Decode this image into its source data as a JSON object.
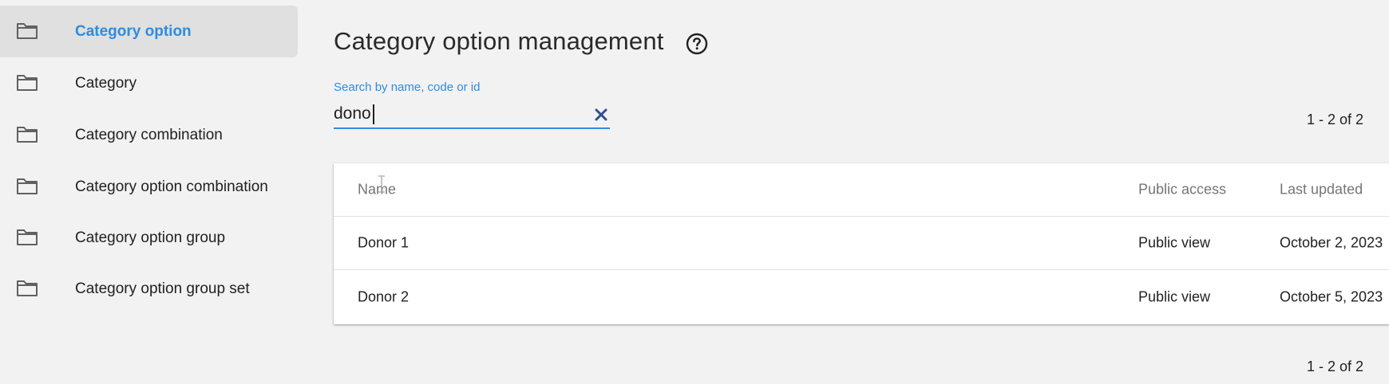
{
  "sidebar": {
    "items": [
      {
        "label": "Category option",
        "icon": "folder-icon",
        "active": true
      },
      {
        "label": "Category",
        "icon": "folder-icon"
      },
      {
        "label": "Category combination",
        "icon": "folder-icon"
      },
      {
        "label": "Category option combination",
        "icon": "folder-icon"
      },
      {
        "label": "Category option group",
        "icon": "folder-icon"
      },
      {
        "label": "Category option group set",
        "icon": "folder-icon"
      }
    ]
  },
  "header": {
    "title": "Category option management",
    "help_icon": "help-circle-icon"
  },
  "search": {
    "label": "Search by name, code or id",
    "value": "dono",
    "clear_icon": "close-icon"
  },
  "pagination": {
    "top": "1 - 2 of 2",
    "bottom": "1 - 2 of 2"
  },
  "table": {
    "columns": [
      "Name",
      "Public access",
      "Last updated"
    ],
    "rows": [
      {
        "name": "Donor 1",
        "public_access": "Public view",
        "last_updated": "October 2, 2023"
      },
      {
        "name": "Donor 2",
        "public_access": "Public view",
        "last_updated": "October 5, 2023"
      }
    ]
  },
  "colors": {
    "accent": "#2d8ce2",
    "background": "#f2f2f2",
    "active_nav_bg": "#e0e0e0",
    "clear_icon": "#2f4f8f"
  }
}
